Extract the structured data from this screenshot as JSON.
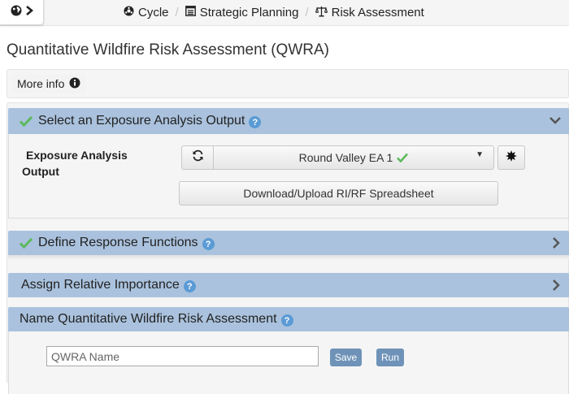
{
  "nav": {
    "toggle_icons": [
      "globe-icon",
      "chevron-right-icon"
    ]
  },
  "breadcrumb": [
    {
      "label": "Cycle",
      "icon": "cycle-icon"
    },
    {
      "label": "Strategic Planning",
      "icon": "document-list-icon"
    },
    {
      "label": "Risk Assessment",
      "icon": "scales-icon"
    }
  ],
  "page": {
    "title": "Quantitative Wildfire Risk Assessment (QWRA)"
  },
  "more_info": {
    "label": "More info",
    "icon": "info-circle-icon"
  },
  "sections": {
    "exposure": {
      "title": "Select an Exposure Analysis Output",
      "complete": true,
      "field_label_line1": "Exposure Analysis",
      "field_label_line2": "Output",
      "selected_value": "Round Valley EA 1",
      "download_label": "Download/Upload RI/RF Spreadsheet"
    },
    "response": {
      "title": "Define Response Functions",
      "complete": true
    },
    "importance": {
      "title": "Assign Relative Importance",
      "complete": false
    },
    "name": {
      "title": "Name Quantitative Wildfire Risk Assessment",
      "input_placeholder": "QWRA Name",
      "input_value": "",
      "save_label": "Save",
      "run_label": "Run"
    }
  },
  "colors": {
    "panel_header": "#aac2dd",
    "check_green": "#5cb85c",
    "help_blue": "#5b9bd5",
    "button_blue": "#6f93b8"
  }
}
